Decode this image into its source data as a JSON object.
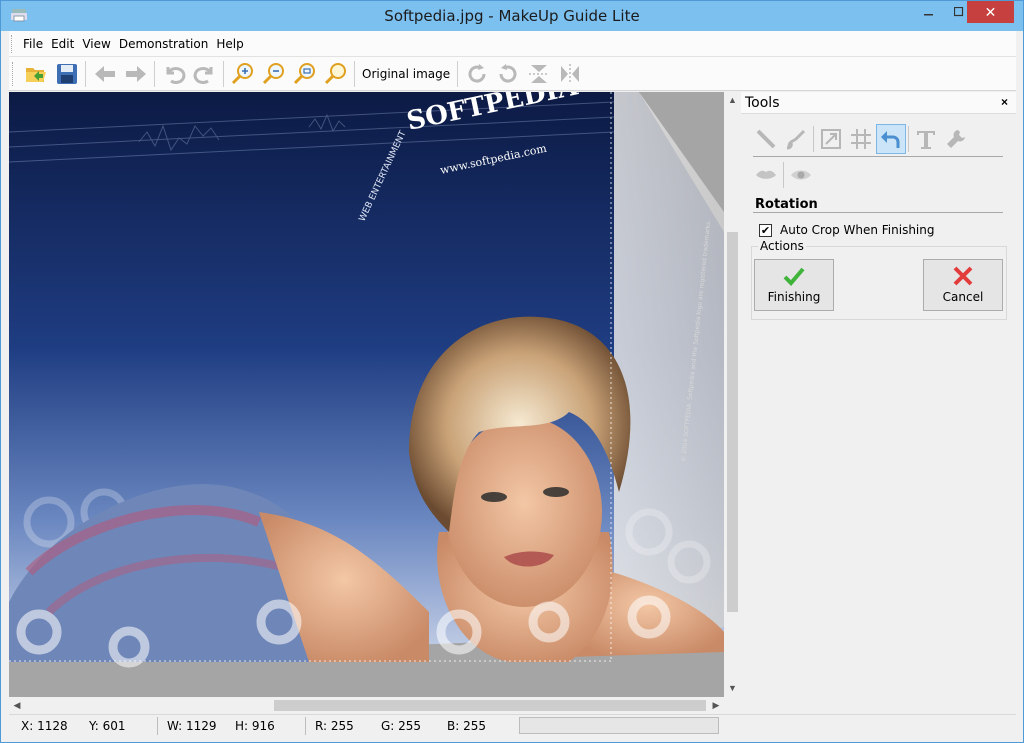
{
  "window": {
    "title": "Softpedia.jpg - MakeUp Guide Lite"
  },
  "menu": {
    "items": [
      "File",
      "Edit",
      "View",
      "Demonstration",
      "Help"
    ]
  },
  "toolbar": {
    "original_image_label": "Original image",
    "icons": [
      "open-icon",
      "save-icon",
      "back-arrow-icon",
      "forward-arrow-icon",
      "undo-icon",
      "redo-icon",
      "zoom-in-icon",
      "zoom-out-icon",
      "zoom-fit-icon",
      "zoom-actual-icon",
      "rotate-right-icon",
      "rotate-left-icon",
      "flip-vertical-icon",
      "flip-horizontal-icon"
    ]
  },
  "image": {
    "brand_text": "SOFTPEDIA",
    "url_text": "www.softpedia.com",
    "arc_text": "WEB ENTERTAINMENT",
    "side_text": "© 2004 SOFTPEDIA. Softpedia and the Softpedia logo are registered trademarks."
  },
  "tools_panel": {
    "title": "Tools",
    "close_label": "×",
    "section_title": "Rotation",
    "auto_crop_label": "Auto Crop When Finishing",
    "auto_crop_checked": true,
    "actions_label": "Actions",
    "finishing_label": "Finishing",
    "cancel_label": "Cancel"
  },
  "status": {
    "x": "X: 1128",
    "y": "Y: 601",
    "w": "W: 1129",
    "h": "H: 916",
    "r": "R: 255",
    "g": "G: 255",
    "b": "B: 255"
  },
  "colors": {
    "title_bar": "#7cc0f0",
    "close_button": "#c74040",
    "active_tool": "#cce4f7",
    "canvas_bg": "#a5a5a5"
  }
}
